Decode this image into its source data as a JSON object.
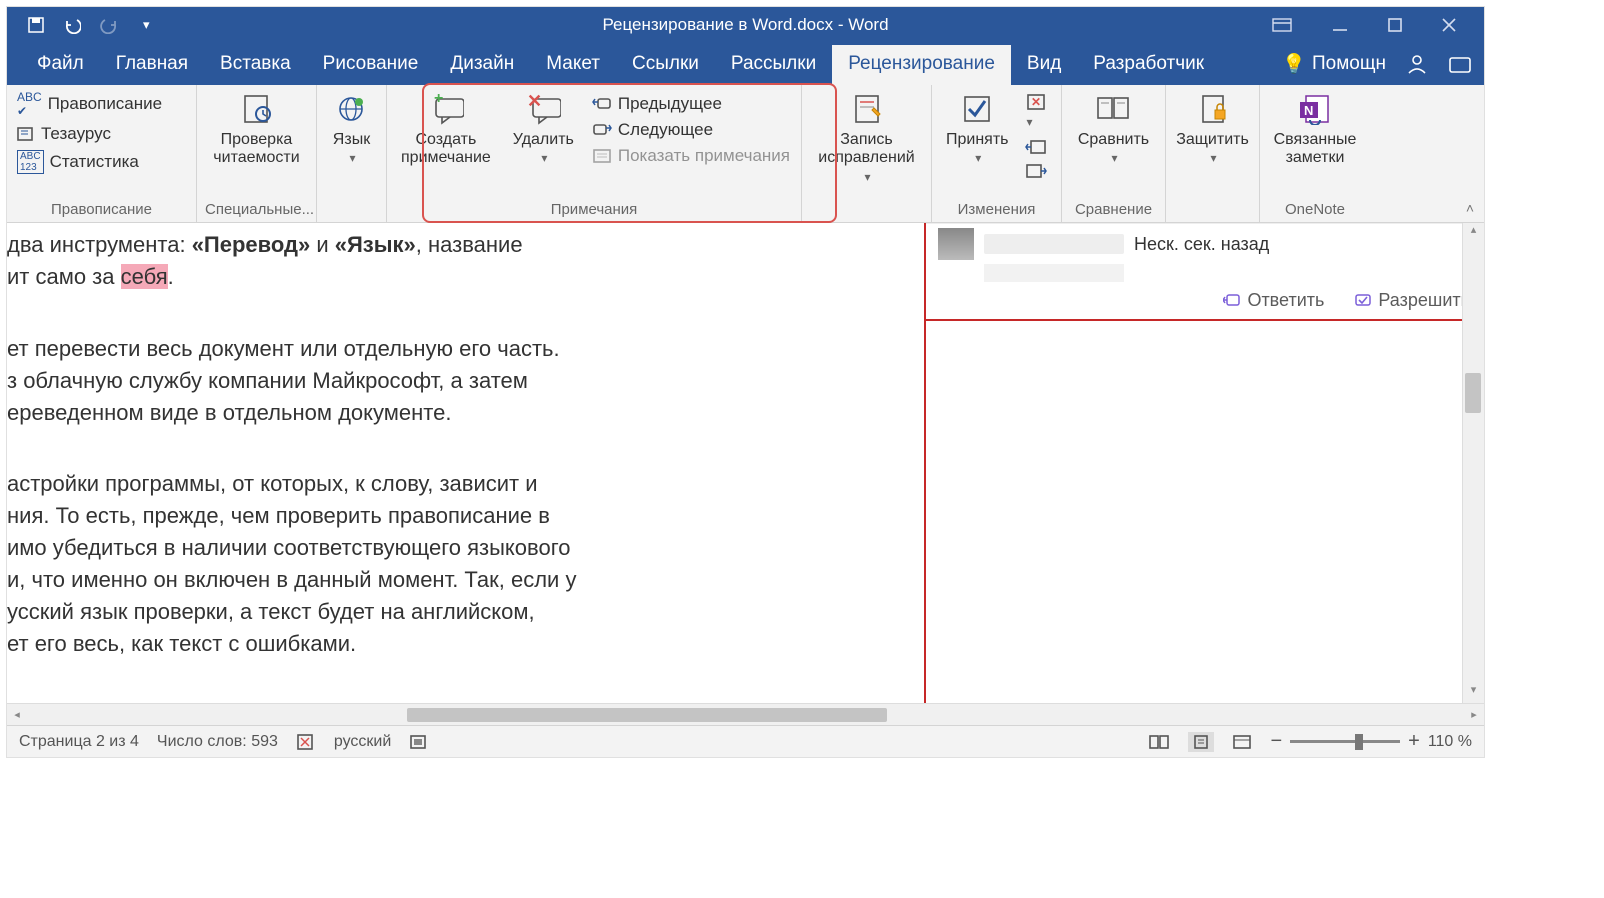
{
  "title": "Рецензирование в Word.docx  -  Word",
  "tabs": [
    "Файл",
    "Главная",
    "Вставка",
    "Рисование",
    "Дизайн",
    "Макет",
    "Ссылки",
    "Рассылки",
    "Рецензирование",
    "Вид",
    "Разработчик"
  ],
  "active_tab": "Рецензирование",
  "tellme": "Помощн",
  "groups": {
    "proofing": {
      "spelling": "Правописание",
      "thesaurus": "Тезаурус",
      "stats": "Статистика",
      "label": "Правописание"
    },
    "readability": {
      "btn": "Проверка\nчитаемости",
      "label": "Специальные..."
    },
    "language": {
      "btn": "Язык",
      "label": ""
    },
    "comments": {
      "new": "Создать\nпримечание",
      "delete": "Удалить",
      "prev": "Предыдущее",
      "next": "Следующее",
      "show": "Показать примечания",
      "label": "Примечания"
    },
    "tracking": {
      "btn": "Запись\nисправлений",
      "label": ""
    },
    "changes": {
      "accept": "Принять",
      "label": "Изменения"
    },
    "compare": {
      "btn": "Сравнить",
      "label": "Сравнение"
    },
    "protect": {
      "btn": "Защитить",
      "label": ""
    },
    "onenote": {
      "btn": "Связанные\nзаметки",
      "label": "OneNote"
    }
  },
  "doc_lines": {
    "l1a": "два инструмента: ",
    "l1b": "«Перевод»",
    "l1c": " и ",
    "l1d": "«Язык»",
    "l1e": ", название",
    "l2a": "ит само за ",
    "l2b": "себя",
    "l2c": ".",
    "l3": "ет перевести весь документ или отдельную его часть.",
    "l4": "з облачную службу компании Майкрософт, а затем",
    "l5": "ереведенном виде в отдельном документе.",
    "l6": "астройки программы, от которых, к слову, зависит и",
    "l7": "ния. То есть, прежде, чем проверить правописание в",
    "l8": "имо убедиться в наличии соответствующего языкового",
    "l9": "и, что именно он включен в данный момент. Так, если у",
    "l10": "усский язык проверки, а текст будет на английском,",
    "l11": "ет его весь, как текст с ошибками."
  },
  "comment": {
    "time": "Неск. сек. назад",
    "reply": "Ответить",
    "resolve": "Разрешить"
  },
  "status": {
    "page": "Страница 2 из 4",
    "words": "Число слов: 593",
    "lang": "русский",
    "zoom": "110 %"
  }
}
